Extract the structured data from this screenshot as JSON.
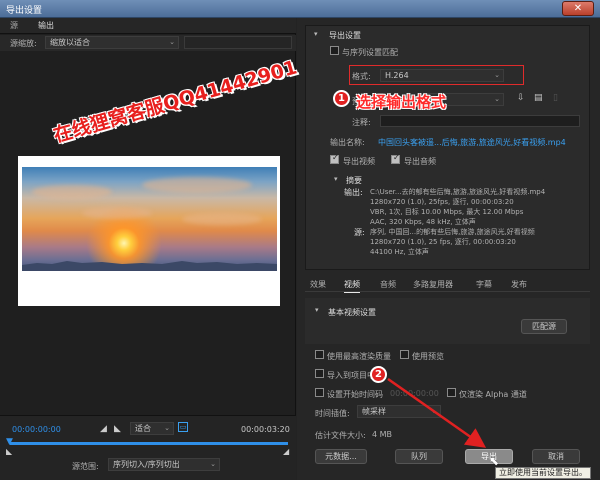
{
  "window": {
    "title": "导出设置",
    "close_label": "✕"
  },
  "left_panel": {
    "tabs": [
      "源",
      "输出"
    ],
    "source_scale_label": "源缩放:",
    "source_scale_value": "缩放以适合",
    "timecode_start": "00:00:00:00",
    "timecode_end": "00:00:03:20",
    "fit_value": "适合",
    "source_range_label": "源范围:",
    "source_range_value": "序列切入/序列切出"
  },
  "export_settings": {
    "heading": "导出设置",
    "match_sequence": "与序列设置匹配",
    "format_label": "格式:",
    "format_value": "H.264",
    "preset_label": "预设:",
    "comment_label": "注释:",
    "output_name_label": "输出名称:",
    "output_name_value": "中国回头客被遥...后悔,旅游,旅途风光,好看视频.mp4",
    "export_video_label": "导出视频",
    "export_audio_label": "导出音频",
    "export_video_checked": true,
    "export_audio_checked": true,
    "summary_heading": "摘要",
    "output_label": "输出:",
    "output_lines": [
      "C:\\User...去的郁有些后悔,旅游,旅途风光,好看视频.mp4",
      "1280x720 (1.0), 25fps, 逐行, 00:00:03:20",
      "VBR, 1次, 目标 10.00 Mbps, 最大 12.00 Mbps",
      "AAC, 320 Kbps, 48 kHz, 立体声"
    ],
    "source_label": "源:",
    "source_lines": [
      "序列, 中国回...的郁有些后悔,旅游,旅途风光,好看视频",
      "1280x720 (1.0), 25 fps, 逐行, 00:00:03:20",
      "44100 Hz, 立体声"
    ]
  },
  "settings_tabs": [
    "效果",
    "视频",
    "音频",
    "多路复用器",
    "字幕",
    "发布"
  ],
  "active_settings_tab": "视频",
  "basic_video": {
    "heading": "基本视频设置",
    "match_source_button": "匹配源"
  },
  "options": {
    "max_render_quality": "使用最高渲染质量",
    "use_previews": "使用预览",
    "import_into_project": "导入到项目中",
    "set_start_timecode": "设置开始时间码",
    "start_timecode_value": "00:00:00:00",
    "render_alpha_only": "仅渲染 Alpha 通道",
    "time_interpolation_label": "时间插值:",
    "time_interpolation_value": "帧采样",
    "file_size_label": "估计文件大小:",
    "file_size_value": "4 MB"
  },
  "buttons": {
    "metadata": "元数据...",
    "queue": "队列",
    "export": "导出",
    "cancel": "取消"
  },
  "tooltip": "立即使用当前设置导出。",
  "annotations": {
    "watermark": "在线狸窝客服QQ41442901",
    "step1_number": "1",
    "step1_text": "选择输出格式",
    "step2_number": "2"
  },
  "colors": {
    "accent_blue": "#3aa0f0",
    "annotation_red": "#e02121",
    "panel_bg": "#262626"
  }
}
